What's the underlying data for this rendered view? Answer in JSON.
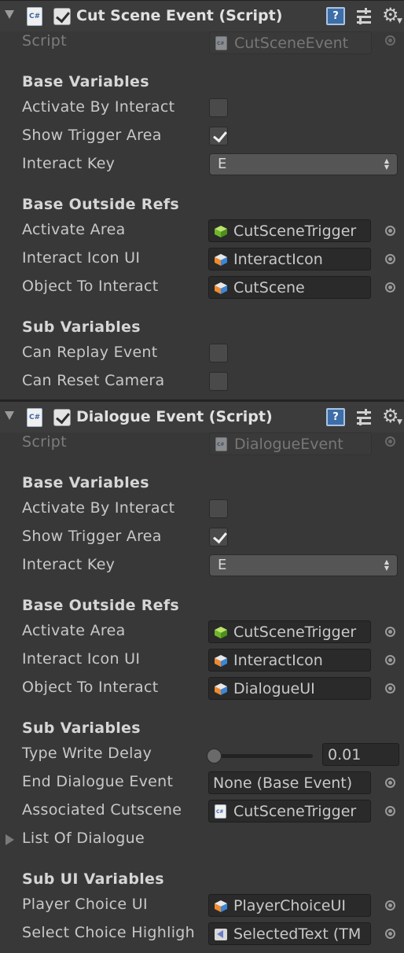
{
  "components": [
    {
      "title": "Cut Scene Event (Script)",
      "enabled": true,
      "script_label": "Script",
      "script_value": "CutSceneEvent",
      "sections": {
        "base_variables": "Base Variables",
        "base_outside_refs": "Base Outside Refs",
        "sub_variables": "Sub Variables"
      },
      "activate_by_interact": {
        "label": "Activate By Interact",
        "checked": false
      },
      "show_trigger_area": {
        "label": "Show Trigger Area",
        "checked": true
      },
      "interact_key": {
        "label": "Interact Key",
        "value": "E"
      },
      "activate_area": {
        "label": "Activate Area",
        "value": "CutSceneTrigger"
      },
      "interact_icon_ui": {
        "label": "Interact Icon UI",
        "value": "InteractIcon"
      },
      "object_to_interact": {
        "label": "Object To Interact",
        "value": "CutScene"
      },
      "can_replay_event": {
        "label": "Can Replay Event",
        "checked": false
      },
      "can_reset_camera": {
        "label": "Can Reset Camera",
        "checked": false
      }
    },
    {
      "title": "Dialogue Event (Script)",
      "enabled": true,
      "script_label": "Script",
      "script_value": "DialogueEvent",
      "sections": {
        "base_variables": "Base Variables",
        "base_outside_refs": "Base Outside Refs",
        "sub_variables": "Sub Variables",
        "sub_ui_variables": "Sub UI Variables"
      },
      "activate_by_interact": {
        "label": "Activate By Interact",
        "checked": false
      },
      "show_trigger_area": {
        "label": "Show Trigger Area",
        "checked": true
      },
      "interact_key": {
        "label": "Interact Key",
        "value": "E"
      },
      "activate_area": {
        "label": "Activate Area",
        "value": "CutSceneTrigger"
      },
      "interact_icon_ui": {
        "label": "Interact Icon UI",
        "value": "InteractIcon"
      },
      "object_to_interact": {
        "label": "Object To Interact",
        "value": "DialogueUI"
      },
      "type_write_delay": {
        "label": "Type Write Delay",
        "value": "0.01",
        "slider_fraction": 0.01
      },
      "end_dialogue_event": {
        "label": "End Dialogue Event",
        "value": "None (Base Event)"
      },
      "associated_cutscene": {
        "label": "Associated Cutscene",
        "value": "CutSceneTrigger"
      },
      "list_of_dialogue": {
        "label": "List Of Dialogue"
      },
      "player_choice_ui": {
        "label": "Player Choice UI",
        "value": "PlayerChoiceUI"
      },
      "select_choice_highlight": {
        "label": "Select Choice Highligh",
        "value": "SelectedText (TM"
      }
    }
  ],
  "icons": {
    "script": "csharp-script-icon",
    "gameobject": "cube-icon",
    "tmp": "textmeshpro-icon",
    "help": "help-book-icon",
    "preset": "preset-sliders-icon",
    "settings": "gear-icon"
  }
}
